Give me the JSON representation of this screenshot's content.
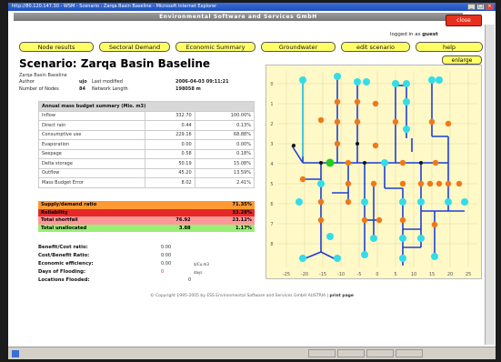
{
  "window": {
    "title": "http://80.120.147.30 - WSM - Scenario : Zarqa Basin Baseline - Microsoft Internet Explorer",
    "controls": [
      "_",
      "□",
      "×"
    ]
  },
  "banner": "Environmental Software and Services GmbH",
  "close_label": "close",
  "login": {
    "prefix": "logged in as",
    "user": "guest"
  },
  "nav": [
    "Node results",
    "Sectoral Demand",
    "Economic Summary",
    "Groundwater",
    "edit scenario",
    "help"
  ],
  "enlarge_label": "enlarge",
  "scenario": {
    "title": "Scenario: Zarqa Basin Baseline",
    "subtitle": "Zarqa Basin Baseline",
    "author_label": "Author",
    "author": "ujo",
    "modified_label": "Last modified",
    "modified": "2006-04-03 09:11:21",
    "nodes_label": "Number of Nodes",
    "nodes": "84",
    "length_label": "Network Length",
    "length": "198058 m"
  },
  "budget": {
    "header": "Annual mass budget summary (Mio. m3)",
    "rows": [
      {
        "label": "Inflow",
        "value": "332.70",
        "pct": "100.00%"
      },
      {
        "label": "Direct rain",
        "value": "0.44",
        "pct": "0.13%"
      },
      {
        "label": "Consumptive use",
        "value": "229.16",
        "pct": "68.88%"
      },
      {
        "label": "Evaporation",
        "value": "0.00",
        "pct": "0.00%"
      },
      {
        "label": "Seepage",
        "value": "0.58",
        "pct": "0.18%"
      },
      {
        "label": "Delta storage",
        "value": "50.19",
        "pct": "15.08%"
      },
      {
        "label": "Outflow",
        "value": "45.20",
        "pct": "13.59%"
      },
      {
        "label": "Mass Budget Error",
        "value": "8.02",
        "pct": "2.41%"
      }
    ]
  },
  "summary": [
    {
      "label": "Supply/demand ratio",
      "value": "",
      "pct": "71.35%",
      "color": "#ff9933"
    },
    {
      "label": "Reliability",
      "value": "",
      "pct": "33.28%",
      "color": "#e62828"
    },
    {
      "label": "Total shortfall",
      "value": "76.92",
      "pct": "23.12%",
      "color": "#ff9999"
    },
    {
      "label": "Total unallocated",
      "value": "3.88",
      "pct": "1.17%",
      "color": "#99ee77"
    }
  ],
  "performance": [
    {
      "label": "Benefit/Cost ratio:",
      "value": "0.00",
      "unit": ""
    },
    {
      "label": "Cost/Benefit Ratio:",
      "value": "0.00",
      "unit": ""
    },
    {
      "label": "Economic efficiency:",
      "value": "0.00",
      "unit": "$/Cu.m3"
    },
    {
      "label": "Days of Flooding:",
      "value": "0",
      "unit": "days"
    },
    {
      "label": "Locations Flooded:",
      "value": "0",
      "unit": ""
    }
  ],
  "map": {
    "x_ticks": [
      "-25",
      "-20",
      "-15",
      "-10",
      "-5",
      "0",
      "5",
      "10",
      "15",
      "20",
      "25"
    ],
    "y_ticks": [
      "0",
      "1",
      "2",
      "3",
      "4",
      "5",
      "6",
      "7",
      "8"
    ],
    "colors": {
      "line": "#1f3fcf",
      "supply": "#33dde8",
      "demand": "#f07818",
      "junction": "#111111",
      "active": "#22cc22",
      "background": "#fff9c8"
    }
  },
  "footer": {
    "text": "© Copyright 1995-2005 by   ESS  Environmental Software and Services GmbH AUSTRIA",
    "print": "print page"
  }
}
